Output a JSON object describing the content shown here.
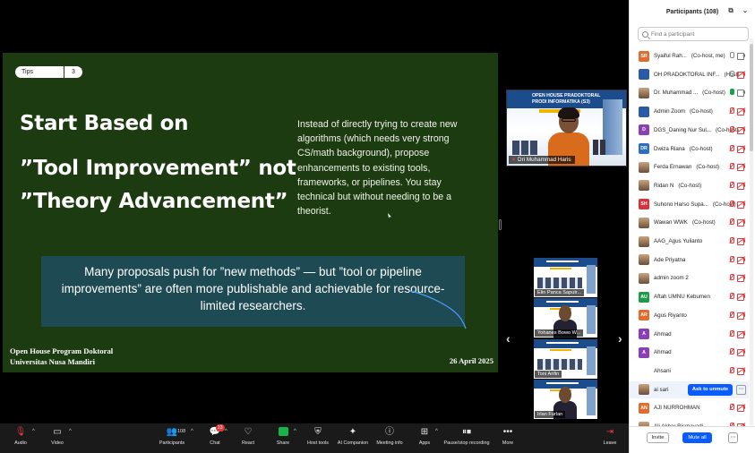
{
  "slide": {
    "tips_label": "Tips",
    "tips_number": "3",
    "heading_line1": "Start Based on",
    "heading_line2": "”Tool Improvement” not",
    "heading_line3": "”Theory Advancement”",
    "body": "Instead of directly trying to create new algorithms (which needs very strong CS/math background), propose enhancements to existing tools, frameworks, or pipelines. You stay technical but without needing to be a theorist.",
    "callout": "Many proposals push for ”new methods” — but ”tool or pipeline improvements” are often more publishable and achievable for resource-limited researchers.",
    "footer_line1": "Open House Program Doktoral",
    "footer_line2": "Universitas Nusa Mandiri",
    "date": "26 April 2025",
    "bg_color": "#1c3b10",
    "callout_color": "#1d4a53"
  },
  "speaker": {
    "banner_line1": "OPEN HOUSE PRADOKTORAL",
    "banner_line2": "PRODI INFORMATIKA (S3)",
    "name": "Dri Muhammad Haris"
  },
  "thumbnails": [
    {
      "name": "Elin Panca Saputr..."
    },
    {
      "name": "Yohanes Bowo W..."
    },
    {
      "name": "Toni Arifin"
    },
    {
      "name": "Irlan Furlan"
    }
  ],
  "participants": {
    "title": "Participants (108)",
    "search_placeholder": "Find a participant",
    "rows": [
      {
        "initials": "SR",
        "color": "#e26b2e",
        "name": "Syaiful Rah...",
        "role": "(Co-host, me)",
        "mic": "gray",
        "cam": "gray"
      },
      {
        "initials": "",
        "color": "#2b5aa8",
        "name": "OH PRADOKTORAL INF...",
        "role": "(Host)",
        "mic": "gray",
        "cam": "off"
      },
      {
        "initials": "",
        "color": "photo",
        "name": "Dr. Muhammad ...",
        "role": "(Co-host)",
        "mic": "on",
        "cam": "gray"
      },
      {
        "initials": "",
        "color": "#2b5aa8",
        "name": "Admin Zoom",
        "role": "(Co-host)",
        "mic": "off",
        "cam": "off"
      },
      {
        "initials": "D",
        "color": "#8a3fb8",
        "name": "DGS_Daning Nur Sul...",
        "role": "(Co-host)",
        "mic": "off",
        "cam": "off"
      },
      {
        "initials": "DR",
        "color": "#2e6fbf",
        "name": "Dwiza Riana",
        "role": "(Co-host)",
        "mic": "off",
        "cam": "off"
      },
      {
        "initials": "",
        "color": "photo",
        "name": "Ferda Ernawan",
        "role": "(Co-host)",
        "mic": "off",
        "cam": "off"
      },
      {
        "initials": "",
        "color": "photo",
        "name": "Ridan N",
        "role": "(Co-host)",
        "mic": "off",
        "cam": "off"
      },
      {
        "initials": "SH",
        "color": "#d6343c",
        "name": "Suhono Harso  Supa...",
        "role": "(Co-host)",
        "mic": "off",
        "cam": "off"
      },
      {
        "initials": "",
        "color": "photo",
        "name": "Wawan WWK",
        "role": "(Co-host)",
        "mic": "off",
        "cam": "off"
      },
      {
        "initials": "",
        "color": "photo",
        "name": "AAG_Agus Yulianto",
        "role": "",
        "mic": "off",
        "cam": "off"
      },
      {
        "initials": "",
        "color": "photo",
        "name": "Ade Priyatna",
        "role": "",
        "mic": "off",
        "cam": "off"
      },
      {
        "initials": "",
        "color": "photo",
        "name": "admin zoom 2",
        "role": "",
        "mic": "off",
        "cam": "off"
      },
      {
        "initials": "AU",
        "color": "#1f9a4a",
        "name": "Aftah UMNU Kebumen",
        "role": "",
        "mic": "off",
        "cam": "off"
      },
      {
        "initials": "AR",
        "color": "#e26b2e",
        "name": "Agus Riyanto",
        "role": "",
        "mic": "off",
        "cam": "off"
      },
      {
        "initials": "A",
        "color": "#8a3fb8",
        "name": "Ahmad",
        "role": "",
        "mic": "off",
        "cam": "off"
      },
      {
        "initials": "A",
        "color": "#8a3fb8",
        "name": "Ahmad",
        "role": "",
        "mic": "off",
        "cam": "off"
      },
      {
        "initials": "",
        "color": "none",
        "name": "Ahsani",
        "role": "",
        "mic": "off",
        "cam": "off"
      },
      {
        "initials": "",
        "color": "photo",
        "name": "ai sari",
        "role": "",
        "mic": "",
        "cam": ""
      },
      {
        "initials": "AN",
        "color": "#e26b2e",
        "name": "AJI NURROHMAN",
        "role": "",
        "mic": "off",
        "cam": "off"
      },
      {
        "initials": "",
        "color": "photo",
        "name": "Ali Akbar Rismayadi",
        "role": "",
        "mic": "off",
        "cam": "off"
      }
    ],
    "ask_to_unmute": "Ask to unmute",
    "invite": "Invite",
    "mute_all": "Mute all"
  },
  "toolbar": {
    "audio": "Audio",
    "video": "Video",
    "participants": "Participants",
    "participants_count": "108",
    "chat": "Chat",
    "chat_badge": "13",
    "react": "React",
    "share": "Share",
    "host_tools": "Host tools",
    "ai_companion": "AI Companion",
    "meeting_info": "Meeting info",
    "apps": "Apps",
    "recording": "Pause/stop recording",
    "more": "More",
    "leave": "Leave"
  }
}
